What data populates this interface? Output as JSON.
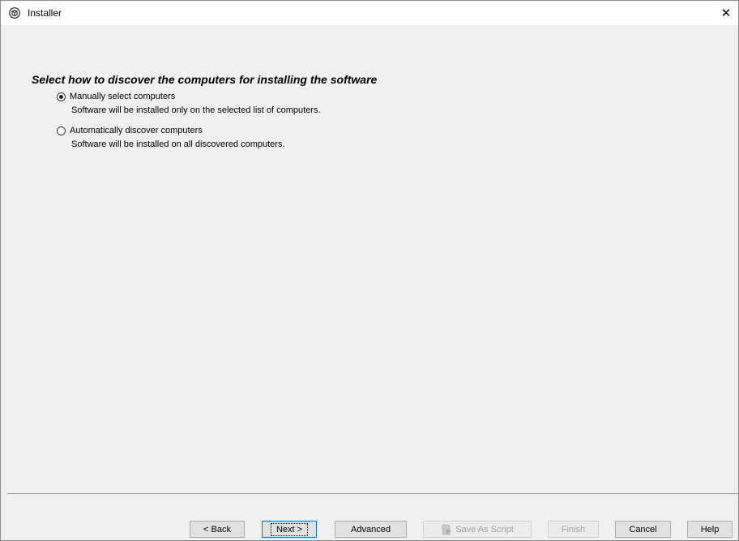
{
  "window": {
    "title": "Installer",
    "close_glyph": "✕"
  },
  "heading": "Select how to discover the computers for installing the software",
  "options": [
    {
      "label": "Manually select computers",
      "description": "Software will be installed only on the selected list of computers.",
      "selected": true
    },
    {
      "label": "Automatically discover computers",
      "description": "Software will be installed on all discovered computers.",
      "selected": false
    }
  ],
  "buttons": {
    "back": "< Back",
    "next": "Next >",
    "advanced": "Advanced",
    "save_as_script": "Save As Script",
    "finish": "Finish",
    "cancel": "Cancel",
    "help": "Help"
  },
  "colors": {
    "background": "#f0f0f0",
    "focus_accent": "#0078d7",
    "disabled_text": "#a0a0a0"
  },
  "icons": {
    "app": "installer-app-icon",
    "script": "script-icon"
  }
}
